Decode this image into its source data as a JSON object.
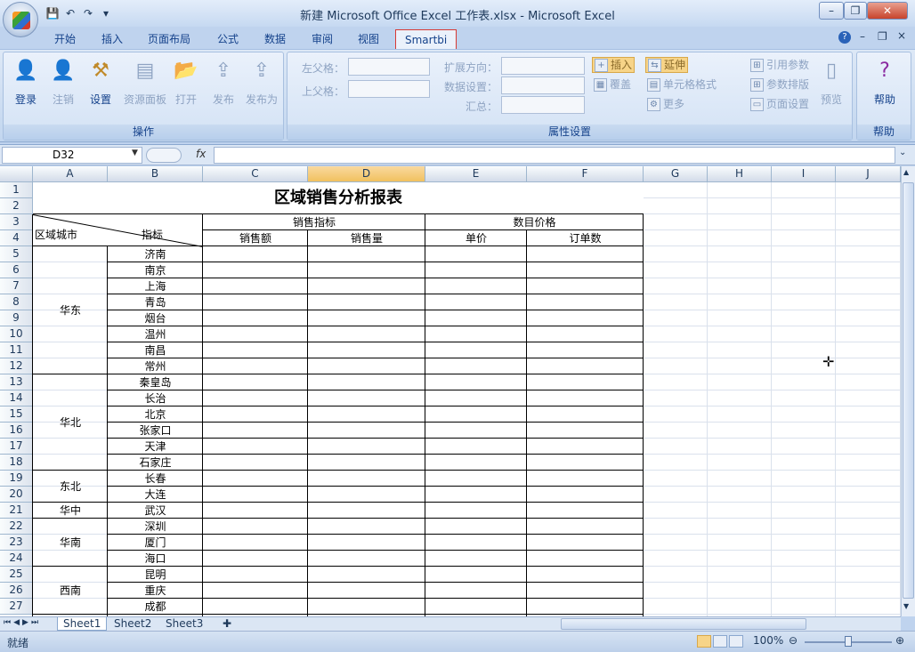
{
  "window": {
    "title": "新建 Microsoft Office Excel 工作表.xlsx - Microsoft Excel",
    "minimize": "–",
    "restore": "❐",
    "close": "✕"
  },
  "qat": {
    "save": "💾",
    "undo": "↶",
    "redo": "↷",
    "more": "▾"
  },
  "tabs": [
    "开始",
    "插入",
    "页面布局",
    "公式",
    "数据",
    "审阅",
    "视图",
    "Smartbi"
  ],
  "ribbon_right": {
    "help": "?",
    "min": "–",
    "restore": "❐",
    "close": "×"
  },
  "groups": {
    "operations": {
      "title": "操作",
      "buttons": [
        "登录",
        "注销",
        "设置",
        "资源面板",
        "打开",
        "发布",
        "发布为"
      ]
    },
    "properties": {
      "title": "属性设置",
      "left_parent": "左父格：",
      "top_parent": "上父格：",
      "expand_dir": "扩展方向：",
      "data_setting": "数据设置：",
      "summary": "汇总：",
      "insert": "插入",
      "cover": "覆盖",
      "extend": "延伸",
      "cell_format": "单元格格式",
      "more": "更多",
      "ref_param": "引用参数",
      "param_layout": "参数排版",
      "page_setup": "页面设置",
      "preview": "预览"
    },
    "help": {
      "title": "帮助",
      "button": "帮助"
    }
  },
  "formula_bar": {
    "cell_ref": "D32",
    "fx": "fx",
    "value": ""
  },
  "columns": [
    "A",
    "B",
    "C",
    "D",
    "E",
    "F",
    "G",
    "H",
    "I",
    "J"
  ],
  "selected_column": "D",
  "rows": [
    "1",
    "2",
    "3",
    "4",
    "5",
    "6",
    "7",
    "8",
    "9",
    "10",
    "11",
    "12",
    "13",
    "14",
    "15",
    "16",
    "17",
    "18",
    "19",
    "20",
    "21",
    "22",
    "23",
    "24",
    "25",
    "26",
    "27"
  ],
  "report": {
    "title": "区域销售分析报表",
    "corner_left": "区域城市",
    "corner_right": "指标",
    "group1": "销售指标",
    "group2": "数目价格",
    "col_sales_amount": "销售额",
    "col_sales_qty": "销售量",
    "col_price": "单价",
    "col_orders": "订单数",
    "regions": [
      {
        "name": "华东",
        "cities": [
          "济南",
          "南京",
          "上海",
          "青岛",
          "烟台",
          "温州",
          "南昌",
          "常州"
        ]
      },
      {
        "name": "华北",
        "cities": [
          "秦皇岛",
          "长治",
          "北京",
          "张家口",
          "天津",
          "石家庄"
        ]
      },
      {
        "name": "东北",
        "cities": [
          "长春",
          "大连"
        ]
      },
      {
        "name": "华中",
        "cities": [
          "武汉"
        ]
      },
      {
        "name": "华南",
        "cities": [
          "深圳",
          "厦门",
          "海口"
        ]
      },
      {
        "name": "西南",
        "cities": [
          "昆明",
          "重庆",
          "成都"
        ]
      }
    ]
  },
  "sheets": [
    "Sheet1",
    "Sheet2",
    "Sheet3"
  ],
  "status": {
    "ready": "就绪",
    "zoom": "100%"
  }
}
